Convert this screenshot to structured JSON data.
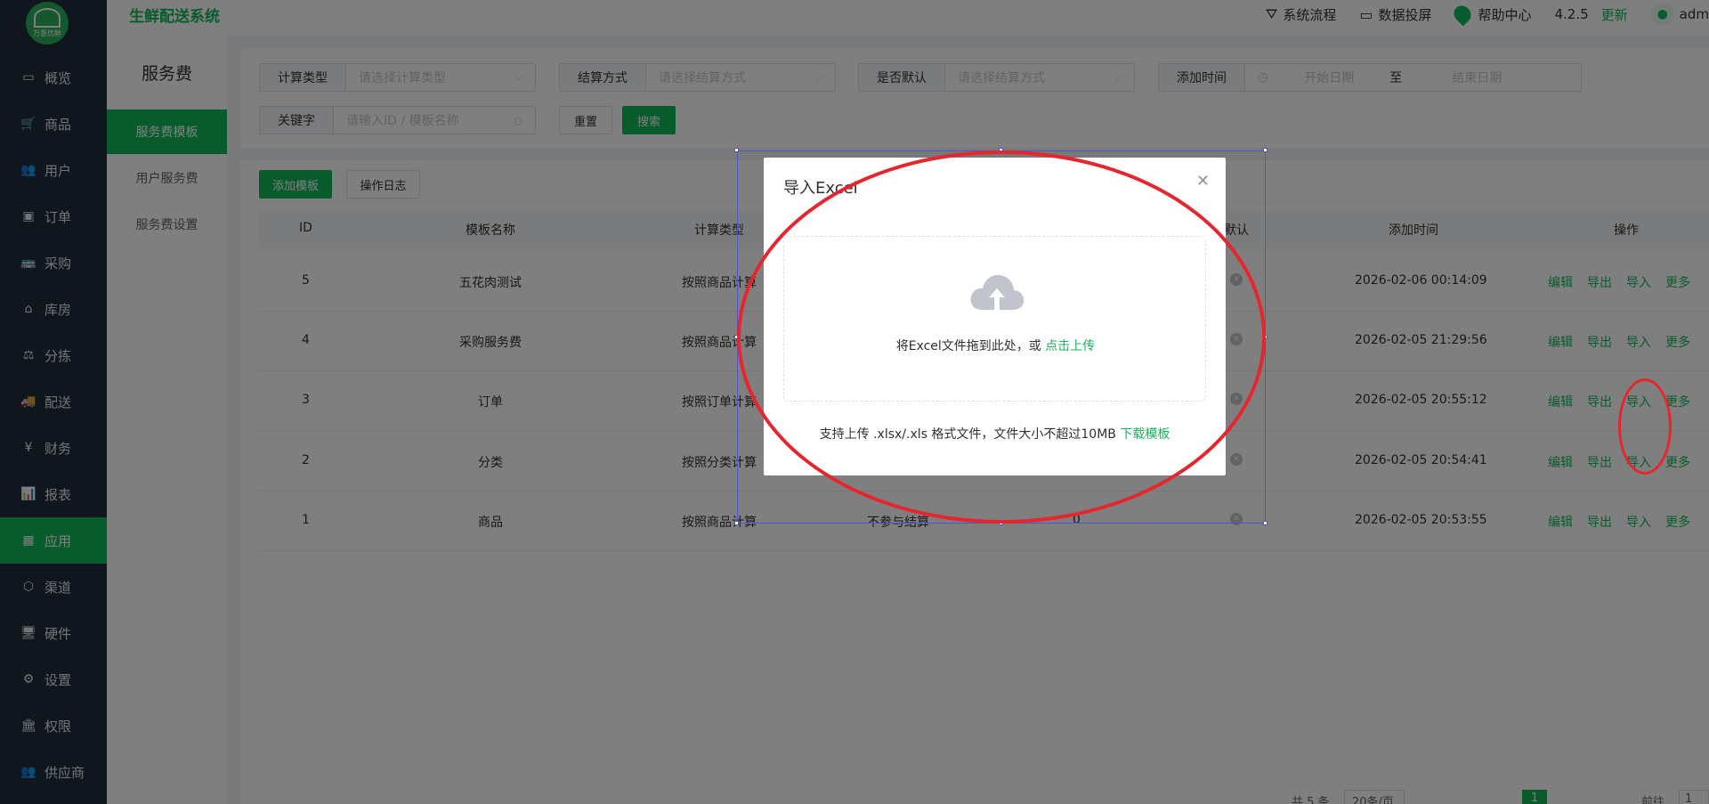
{
  "app": {
    "brand": "生鲜配送系统",
    "logo_text": "万惠优鲜"
  },
  "header": {
    "items": [
      {
        "icon": "flow-icon",
        "label": "系统流程"
      },
      {
        "icon": "screen-icon",
        "label": "数据投屏"
      },
      {
        "icon": "location-pin-icon",
        "label": "帮助中心"
      }
    ],
    "version": "4.2.5",
    "update_label": "更新",
    "user": "adm"
  },
  "sidebar": {
    "items": [
      {
        "icon": "▭",
        "label": "概览"
      },
      {
        "icon": "🛒",
        "label": "商品"
      },
      {
        "icon": "👥",
        "label": "用户"
      },
      {
        "icon": "▣",
        "label": "订单"
      },
      {
        "icon": "🚌",
        "label": "采购"
      },
      {
        "icon": "⌂",
        "label": "库房"
      },
      {
        "icon": "⚖",
        "label": "分拣"
      },
      {
        "icon": "🚚",
        "label": "配送"
      },
      {
        "icon": "¥",
        "label": "财务"
      },
      {
        "icon": "📊",
        "label": "报表"
      },
      {
        "icon": "▦",
        "label": "应用",
        "active": true
      },
      {
        "icon": "⬡",
        "label": "渠道"
      },
      {
        "icon": "🖥",
        "label": "硬件"
      },
      {
        "icon": "⚙",
        "label": "设置"
      },
      {
        "icon": "🏛",
        "label": "权限"
      },
      {
        "icon": "👥",
        "label": "供应商"
      }
    ]
  },
  "subnav": {
    "title": "服务费",
    "items": [
      "服务费模板",
      "用户服务费",
      "服务费设置"
    ]
  },
  "filters": {
    "calc_type": {
      "label": "计算类型",
      "placeholder": "请选择计算类型"
    },
    "settle": {
      "label": "结算方式",
      "placeholder": "请选择结算方式"
    },
    "is_default": {
      "label": "是否默认",
      "placeholder": "请选择结算方式"
    },
    "add_time": {
      "label": "添加时间",
      "start": "开始日期",
      "to": "至",
      "end": "结束日期"
    },
    "keyword": {
      "label": "关键字",
      "placeholder": "请输入ID / 模板名称"
    },
    "reset_label": "重置",
    "search_label": "搜索"
  },
  "toolbar": {
    "add_label": "添加模板",
    "log_label": "操作日志"
  },
  "table": {
    "headers": {
      "id": "ID",
      "name": "模板名称",
      "calc": "计算类型",
      "default": "默认",
      "time": "添加时间",
      "ops": "操作"
    },
    "rows": [
      {
        "id": "5",
        "name": "五花肉测试",
        "calc": "按照商品计算",
        "settle": "",
        "value": "",
        "time": "2026-02-06 00:14:09"
      },
      {
        "id": "4",
        "name": "采购服务费",
        "calc": "按照商品计算",
        "settle": "",
        "value": "",
        "time": "2026-02-05 21:29:56"
      },
      {
        "id": "3",
        "name": "订单",
        "calc": "按照订单计算",
        "settle": "",
        "value": "",
        "time": "2026-02-05 20:55:12"
      },
      {
        "id": "2",
        "name": "分类",
        "calc": "按照分类计算",
        "settle": "",
        "value": "",
        "time": "2026-02-05 20:54:41"
      },
      {
        "id": "1",
        "name": "商品",
        "calc": "按照商品计算",
        "settle": "不参与结算",
        "value": "0",
        "time": "2026-02-05 20:53:55"
      }
    ],
    "actions": [
      "编辑",
      "导出",
      "导入",
      "更多"
    ]
  },
  "pager": {
    "total": "共 5 条",
    "size": "20条/页",
    "page": "1",
    "goto": "前往",
    "goto_value": "1"
  },
  "dialog": {
    "title": "导入Excel",
    "drop_text": "将Excel文件拖到此处，或",
    "drop_link": "点击上传",
    "tip": "支持上传 .xlsx/.xls 格式文件，文件大小不超过10MB",
    "template_link": "下载模板"
  },
  "colors": {
    "accent": "#10b959",
    "sidebar_bg": "#1f2d3d",
    "annotation": "#e6262e"
  }
}
